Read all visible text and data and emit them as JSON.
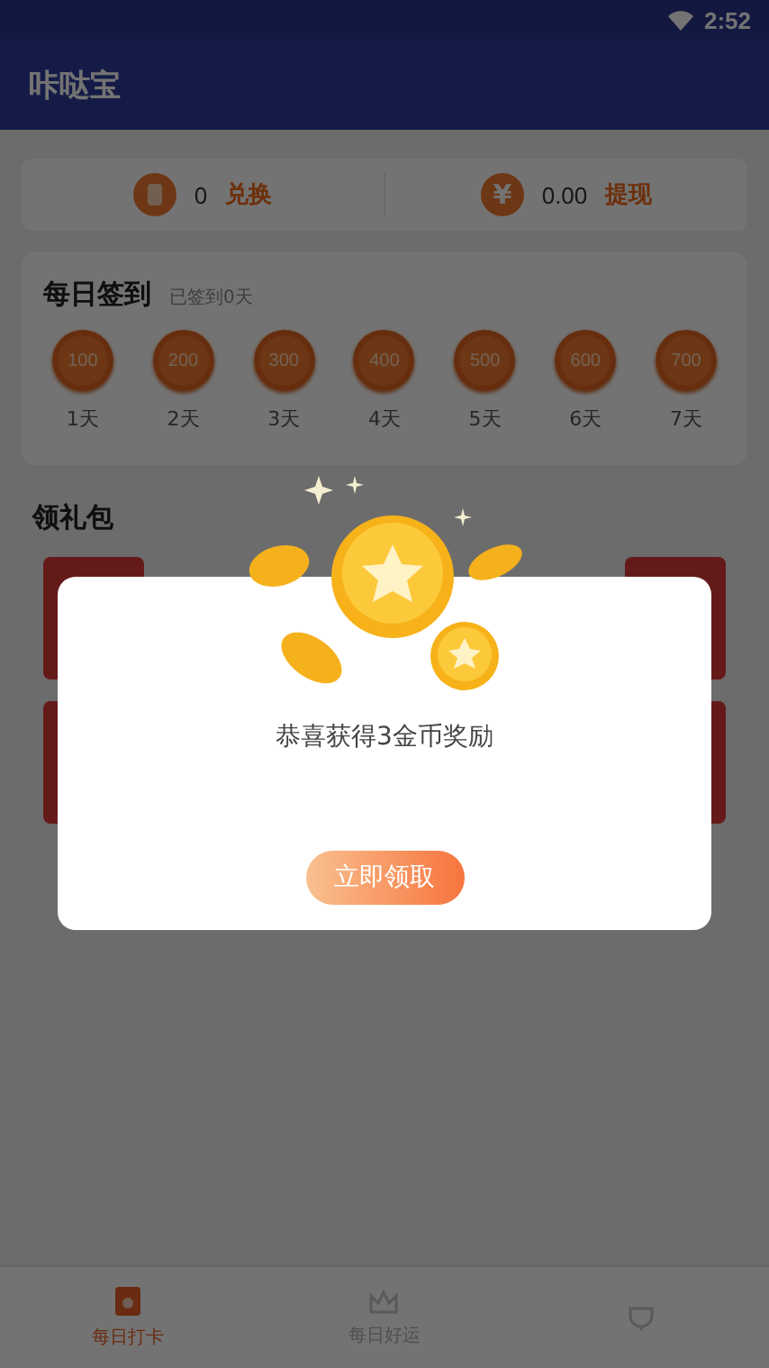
{
  "status_bar": {
    "time": "2:52"
  },
  "app_bar": {
    "title": "咔哒宝"
  },
  "wallet": [
    {
      "kind": "coin",
      "value": "0",
      "action": "兑换"
    },
    {
      "kind": "cash",
      "symbol": "¥",
      "value": "0.00",
      "action": "提现"
    }
  ],
  "checkin": {
    "title": "每日签到",
    "subtitle": "已签到0天",
    "days": [
      {
        "amount": "100",
        "label": "1天"
      },
      {
        "amount": "200",
        "label": "2天"
      },
      {
        "amount": "300",
        "label": "3天"
      },
      {
        "amount": "400",
        "label": "4天"
      },
      {
        "amount": "500",
        "label": "5天"
      },
      {
        "amount": "600",
        "label": "6天"
      },
      {
        "amount": "700",
        "label": "7天"
      }
    ]
  },
  "gifts": {
    "title": "领礼包"
  },
  "dialog": {
    "message": "恭喜获得3金币奖励",
    "button": "立即领取"
  },
  "tabs": [
    {
      "label": "每日打卡",
      "selected": true,
      "kind": "card"
    },
    {
      "label": "每日好运",
      "selected": false,
      "kind": "crown"
    },
    {
      "selected": false,
      "kind": "cup"
    }
  ]
}
